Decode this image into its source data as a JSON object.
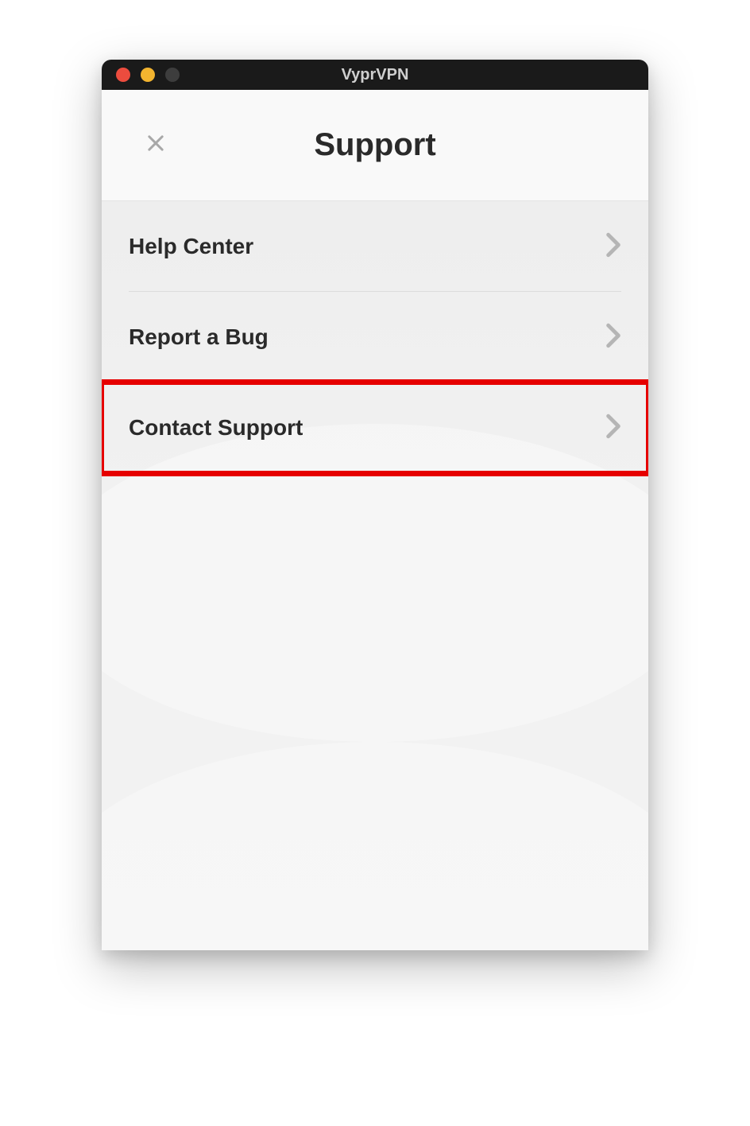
{
  "window": {
    "title": "VyprVPN"
  },
  "header": {
    "title": "Support"
  },
  "menu": {
    "items": [
      {
        "label": "Help Center"
      },
      {
        "label": "Report a Bug"
      },
      {
        "label": "Contact Support"
      }
    ]
  },
  "highlight": {
    "index": 2
  }
}
